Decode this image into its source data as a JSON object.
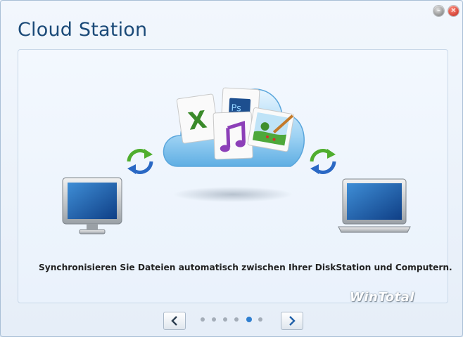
{
  "window": {
    "title": "Cloud Station",
    "controls": [
      "minimize-icon",
      "close-icon"
    ]
  },
  "wizard": {
    "caption": "Synchronisieren Sie Dateien automatisch zwischen Ihrer DiskStation und Computern.",
    "watermark": "WinTotal",
    "pagination": {
      "total": 6,
      "current": 5
    },
    "prev_icon": "chevron-left-icon",
    "next_icon": "chevron-right-icon"
  },
  "illustration": {
    "items": [
      "cloud-icon",
      "excel-file-icon",
      "photoshop-file-icon",
      "music-file-icon",
      "image-file-icon",
      "sync-arrows-icon",
      "desktop-monitor-icon",
      "laptop-icon"
    ]
  },
  "colors": {
    "title": "#1b4a78",
    "accent": "#2f7fd0",
    "close": "#c0241a"
  }
}
